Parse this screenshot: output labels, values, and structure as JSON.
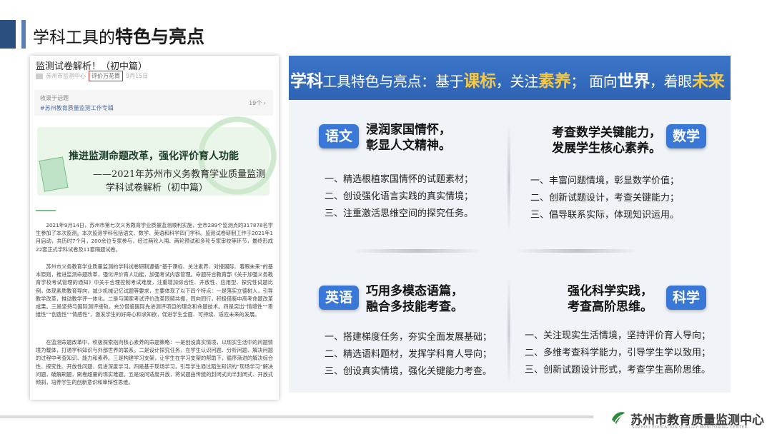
{
  "page": {
    "title_normal": "学科工具的",
    "title_bold": "特色与亮点"
  },
  "article": {
    "heading": "监测试卷解析！（初中篇）",
    "meta_source": "苏州市监测中心",
    "meta_tag": "评价万花筒",
    "meta_date": "9月15日",
    "collect_label": "收录于话题",
    "collect_topic": "#苏州教育质量监测工作专辑",
    "collect_count": "19个 ›",
    "banner_line1": "推进监测命题改革，强化评价育人功能",
    "banner_line2": "——2021年苏州市义务教育学业质量监测",
    "banner_line3": "学科试卷解析（初中篇）",
    "para1": "2021年9月14日，苏州市第七次义务教育学业质量监测顺利实施，全市289个监测点的317878名学生参加了本次监测。本次监测学科包括语文、数学、英语和科学四门学科。监测试卷研制工作于2021年1月启动，共历时7个月，200余位专家参与，经过两轮入闱、两轮预试和多轮专家审校等环节，最终形成22套正式学科试卷及11套隔题试卷。",
    "para2": "苏州市义务教育学业质量监测的学科试卷研制遵循“基于课标、关注素养、对接国际、着眼未来”的基本原则，推进监测命题改革，强化评价育人功能，加强考试内容管理。命题符合教育部《关于加强义务教育学校考试管理的通知》中关于合理控制考试难度，注重增加综合性、开放性、应用型、探究性试题比例，体现素质教育导向，减少机械记忆试题等要求，主要体现了以下四个特点：一是落实立德树人，引导教学改革，推动教学评一体化。二是与国家考试评价改革同频共振，同向同行，积极借鉴中高考命题改革成果。三是坚持与国际测评接轨，充分借鉴国际先进测评项目的理念和命题技术。四是突出“情境性”“思维性”“创造性”“情感性”，激发学生的好奇心和求知欲，促进学生全面、可持续、适应未来的发展。",
    "para3": "在监测命题改革中，积极探索指向核心素养的命题策略：一是创设真实情境，以现实生活中的问题情境为载体，打通学科知识与外部世界的联系。二是设计探究任务，在学生认识问题、分析问题、解决问题的过程中考查知识、能力和素养。三是构建学习支架，让学生在学习支架的帮助下，循序渐进的解决综合性、探究性、开放性问题，促进深度学习。四是基于现场学习，引导学生通过陌生知识的“现场学习”解决问题，破解刷题，刷卷超量的现实难题。五是设问适度开放，将试题由传统的封闭式向半封闭式、开放式倾斜，培养学生的创新意识和审辩性思维。"
  },
  "panel": {
    "header_parts": [
      "学科",
      "工具特色与亮点：基于",
      "课标",
      "，关注",
      "素养",
      "；  面向",
      "世界",
      "，着眼",
      "未来"
    ],
    "quadrants": [
      {
        "badge": "语文",
        "title1": "浸润家国情怀，",
        "title2": "彰显人文精神。",
        "items": [
          "一、精选根植家国情怀的试题素材；",
          "二、创设强化语言实践的真实情境；",
          "三、注重激活思维空间的探究任务。"
        ]
      },
      {
        "badge": "数学",
        "title1": "考查数学关键能力，",
        "title2": "发展学生核心素养。",
        "items": [
          "一、丰富问题情境，彰显数学价值；",
          "二、创新试题设计，考查关键能力；",
          "三、倡导联系实际，体现知识运用。"
        ]
      },
      {
        "badge": "英语",
        "title1": "巧用多模态语篇，",
        "title2": "融合多技能考查。",
        "items": [
          "一、搭建梯度任务，夯实全面发展基础；",
          "二、精选语料题材，发挥学科育人导向；",
          "三、创设真实情境，强化关键能力考查。"
        ]
      },
      {
        "badge": "科学",
        "title1": "强化科学实践，",
        "title2": "考查高阶思维。",
        "items": [
          "一、关注现实生活情境，坚持评价育人导向；",
          "二、多维考查科学能力，引导学生学以致用；",
          "三、创新试题设计形式，考查学生高阶思维。"
        ]
      }
    ]
  },
  "footer": {
    "org_name": "苏州市教育质量监测中心",
    "org_name_en": "SUZHOU EDUCATION QUALITY MONITORING CENTER",
    "logo_color": "#2e8b3a"
  }
}
